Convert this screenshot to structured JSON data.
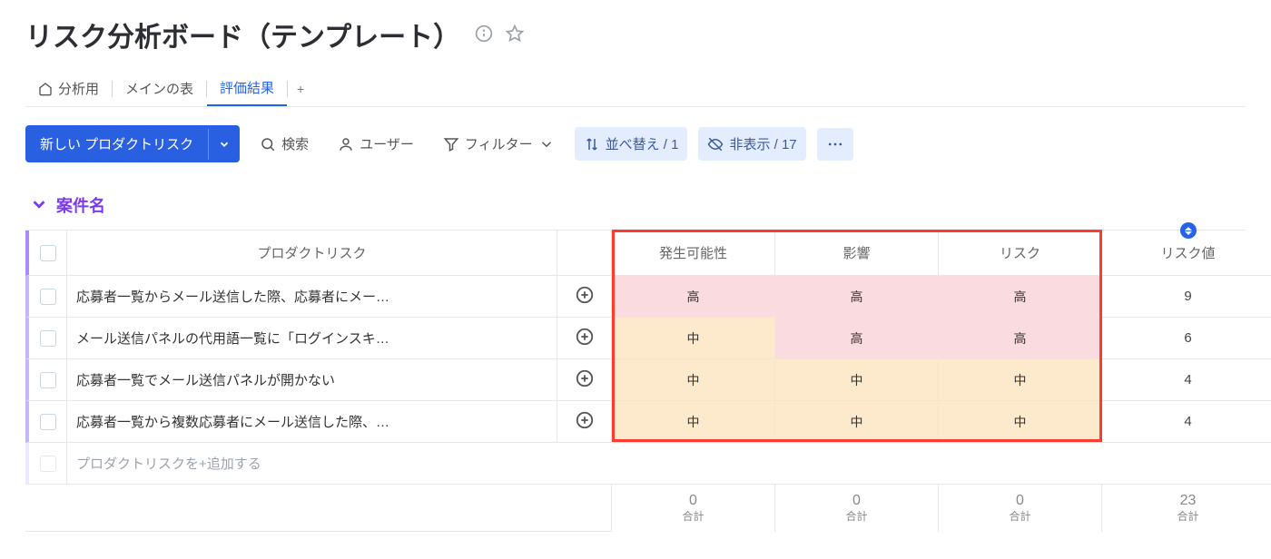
{
  "header": {
    "title": "リスク分析ボード（テンプレート）"
  },
  "tabs": {
    "items": [
      {
        "label": "分析用"
      },
      {
        "label": "メインの表"
      },
      {
        "label": "評価結果"
      }
    ]
  },
  "toolbar": {
    "newButton": "新しい プロダクトリスク",
    "search": "検索",
    "user": "ユーザー",
    "filter": "フィルター",
    "sort": "並べ替え / 1",
    "hide": "非表示 / 17"
  },
  "group": {
    "title": "案件名"
  },
  "columns": {
    "risk": "プロダクトリスク",
    "likelihood": "発生可能性",
    "impact": "影響",
    "riskLevel": "リスク",
    "riskValue": "リスク値"
  },
  "rows": [
    {
      "name": "応募者一覧からメール送信した際、応募者にメー…",
      "likelihood": "高",
      "likelihoodClass": "lv-high",
      "impact": "高",
      "impactClass": "lv-high",
      "riskLevel": "高",
      "riskLevelClass": "lv-high",
      "value": "9"
    },
    {
      "name": "メール送信パネルの代用語一覧に「ログインスキ…",
      "likelihood": "中",
      "likelihoodClass": "lv-mid",
      "impact": "高",
      "impactClass": "lv-high",
      "riskLevel": "高",
      "riskLevelClass": "lv-high",
      "value": "6"
    },
    {
      "name": "応募者一覧でメール送信パネルが開かない",
      "likelihood": "中",
      "likelihoodClass": "lv-mid",
      "impact": "中",
      "impactClass": "lv-mid",
      "riskLevel": "中",
      "riskLevelClass": "lv-mid",
      "value": "4"
    },
    {
      "name": "応募者一覧から複数応募者にメール送信した際、…",
      "likelihood": "中",
      "likelihoodClass": "lv-mid",
      "impact": "中",
      "impactClass": "lv-mid",
      "riskLevel": "中",
      "riskLevelClass": "lv-mid",
      "value": "4"
    }
  ],
  "addRow": "プロダクトリスクを+追加する",
  "footer": {
    "likelihood": {
      "value": "0",
      "label": "合計"
    },
    "impact": {
      "value": "0",
      "label": "合計"
    },
    "riskLevel": {
      "value": "0",
      "label": "合計"
    },
    "riskValue": {
      "value": "23",
      "label": "合計"
    }
  }
}
